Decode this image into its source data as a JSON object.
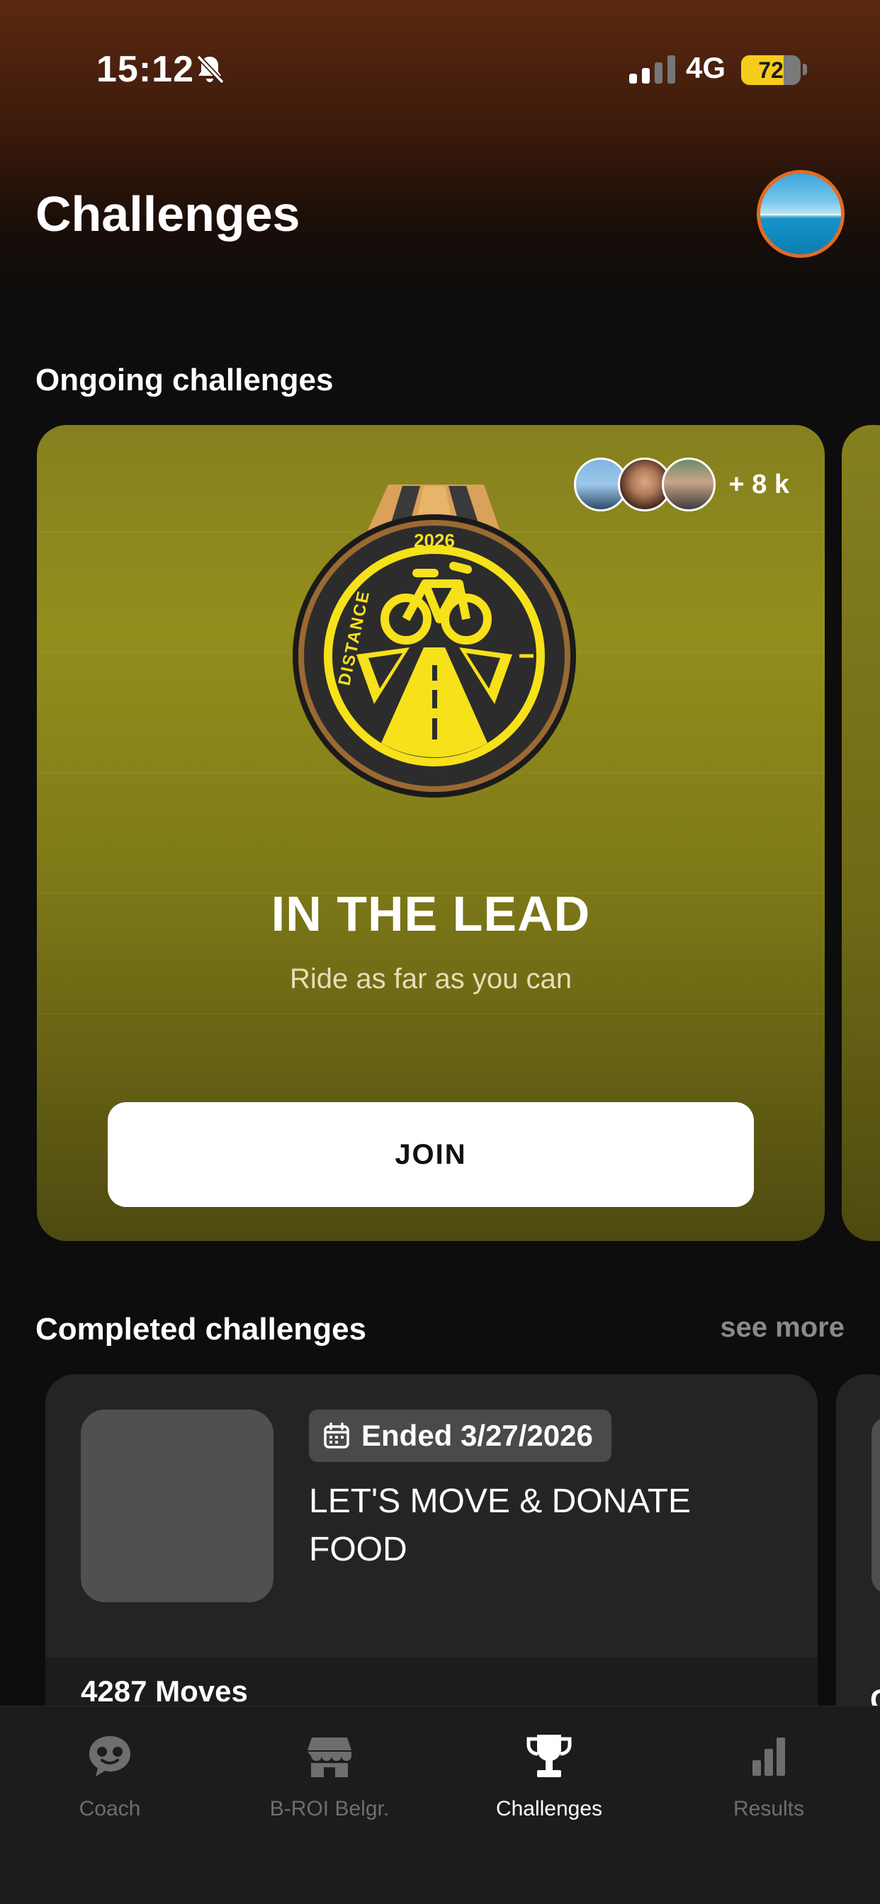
{
  "status_bar": {
    "time": "15:12",
    "network": "4G",
    "battery": "72",
    "battery_level": 0.72
  },
  "header": {
    "title": "Challenges"
  },
  "sections": {
    "ongoing": "Ongoing challenges",
    "completed": "Completed challenges",
    "see_more": "see more"
  },
  "ongoing_challenge": {
    "participants_count": "+ 8 k",
    "medal_year": "2026",
    "medal_label": "DISTANCE",
    "name": "IN THE LEAD",
    "description": "Ride as far as you can",
    "join_label": "JOIN"
  },
  "completed_challenge": {
    "ended": "Ended 3/27/2026",
    "title": "LET'S MOVE & DONATE FOOD",
    "stat": "4287 Moves",
    "next_card_peek_text": "C"
  },
  "tabs": [
    {
      "label": "Coach",
      "icon": "coach-chat-icon",
      "active": false
    },
    {
      "label": "B-ROI Belgr.",
      "icon": "store-icon",
      "active": false
    },
    {
      "label": "Challenges",
      "icon": "trophy-icon",
      "active": true
    },
    {
      "label": "Results",
      "icon": "bar-chart-icon",
      "active": false
    }
  ],
  "colors": {
    "accent_orange": "#e26b24",
    "card_olive": "#938e1c",
    "medal_yellow": "#f6e11a",
    "battery_yellow": "#f6cc1c"
  }
}
